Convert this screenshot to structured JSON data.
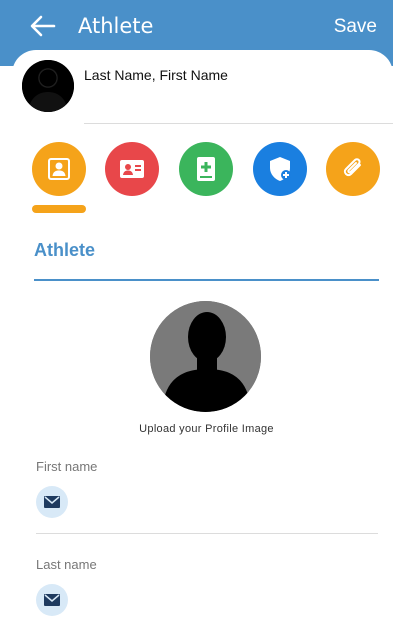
{
  "appbar": {
    "title": "Athlete",
    "save_label": "Save",
    "back_icon": "arrow-left-icon",
    "background": "#4a90c9"
  },
  "profile_header": {
    "name": "Last Name, First Name",
    "avatar_icon": "avatar-silhouette"
  },
  "tabs": [
    {
      "icon": "person-badge-icon",
      "color": "#f5a31a",
      "active": true
    },
    {
      "icon": "contact-card-icon",
      "color": "#e8474a",
      "active": false
    },
    {
      "icon": "medical-book-icon",
      "color": "#3bb55c",
      "active": false
    },
    {
      "icon": "shield-plus-icon",
      "color": "#1a7fe0",
      "active": false
    },
    {
      "icon": "paperclip-icon",
      "color": "#f5a31a",
      "active": false
    }
  ],
  "section": {
    "title": "Athlete",
    "accent": "#4a90c9"
  },
  "profile_image": {
    "upload_label": "Upload your Profile Image"
  },
  "fields": [
    {
      "label": "First name",
      "value": "",
      "icon": "envelope-icon"
    },
    {
      "label": "Last name",
      "value": "",
      "icon": "envelope-icon"
    }
  ]
}
